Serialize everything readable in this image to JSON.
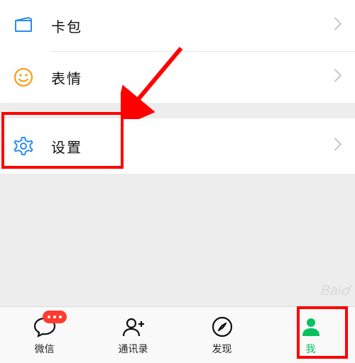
{
  "menu": {
    "wallet": "卡包",
    "stickers": "表情",
    "settings": "设置"
  },
  "tabs": {
    "chats": "微信",
    "contacts": "通讯录",
    "discover": "发现",
    "me": "我"
  },
  "colors": {
    "highlight": "#ff0000",
    "accent_green": "#07c160",
    "icon_blue": "#2d8cf0",
    "icon_orange": "#ff9500"
  },
  "annotations": {
    "highlight_settings": true,
    "highlight_me_tab": true,
    "arrow_pointing_to_settings": true
  }
}
